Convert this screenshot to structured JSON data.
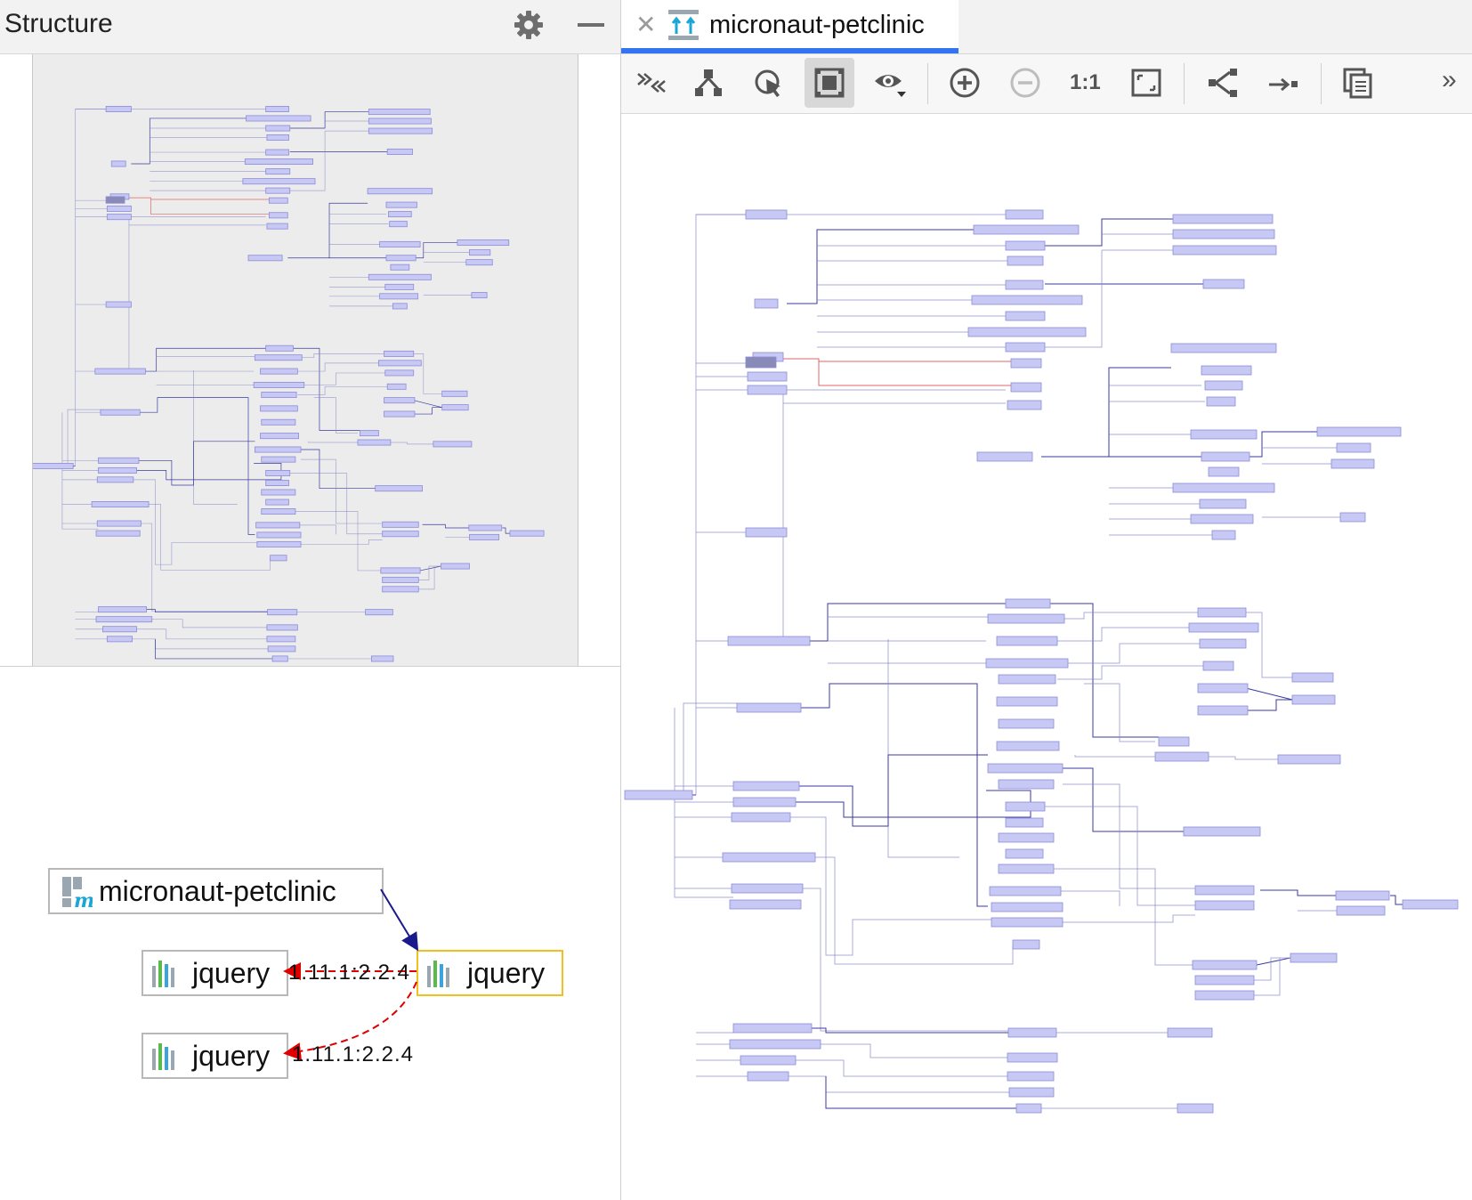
{
  "structure": {
    "title": "Structure",
    "settings_icon": "gear-icon",
    "minimize_icon": "minimize-icon"
  },
  "detail": {
    "root_node": {
      "label": "micronaut-petclinic",
      "icon": "maven-module-icon"
    },
    "nodes": [
      {
        "id": "jquery-selected",
        "label": "jquery",
        "icon": "library-icon",
        "selected": true
      },
      {
        "id": "jquery-a",
        "label": "jquery",
        "icon": "library-icon",
        "selected": false
      },
      {
        "id": "jquery-b",
        "label": "jquery",
        "icon": "library-icon",
        "selected": false
      }
    ],
    "edge_labels": [
      "1.11.1:2.2.4",
      "1.11.1:2.2.4"
    ]
  },
  "editor": {
    "tab": {
      "label": "micronaut-petclinic",
      "icon": "dependency-diagram-icon",
      "close_icon": "close-icon"
    },
    "toolbar": {
      "buttons": [
        {
          "name": "collapse-expand-button",
          "icon": "collapse-arrows-icon"
        },
        {
          "name": "show-structure-button",
          "icon": "hierarchy-icon"
        },
        {
          "name": "select-cursor-button",
          "icon": "cursor-target-icon"
        },
        {
          "name": "fit-content-button",
          "icon": "fit-frame-icon",
          "active": true
        },
        {
          "name": "view-options-button",
          "icon": "eye-dropdown-icon"
        },
        {
          "name": "zoom-in-button",
          "icon": "zoom-in-icon"
        },
        {
          "name": "zoom-out-button",
          "icon": "zoom-out-icon",
          "disabled": true
        },
        {
          "name": "actual-size-button",
          "icon": "actual-size-icon",
          "text": "1:1"
        },
        {
          "name": "fit-window-button",
          "icon": "fit-window-icon"
        },
        {
          "name": "layout-button",
          "icon": "tree-layout-icon"
        },
        {
          "name": "route-edges-button",
          "icon": "arrow-right-icon"
        },
        {
          "name": "copy-diagram-button",
          "icon": "copy-icon"
        },
        {
          "name": "more-button",
          "icon": "double-chevron-right-icon"
        }
      ],
      "more_label": "»"
    }
  },
  "colors": {
    "node_fill": "#c8c8f4",
    "node_stroke": "#8c8cd8",
    "edge": "#3a3aa0",
    "edge_light": "#8888c8",
    "highlight_edge": "#e06666",
    "selected_node_fill": "#8a8ab8",
    "selected_border": "#f0c020",
    "accent": "#3574f0"
  }
}
